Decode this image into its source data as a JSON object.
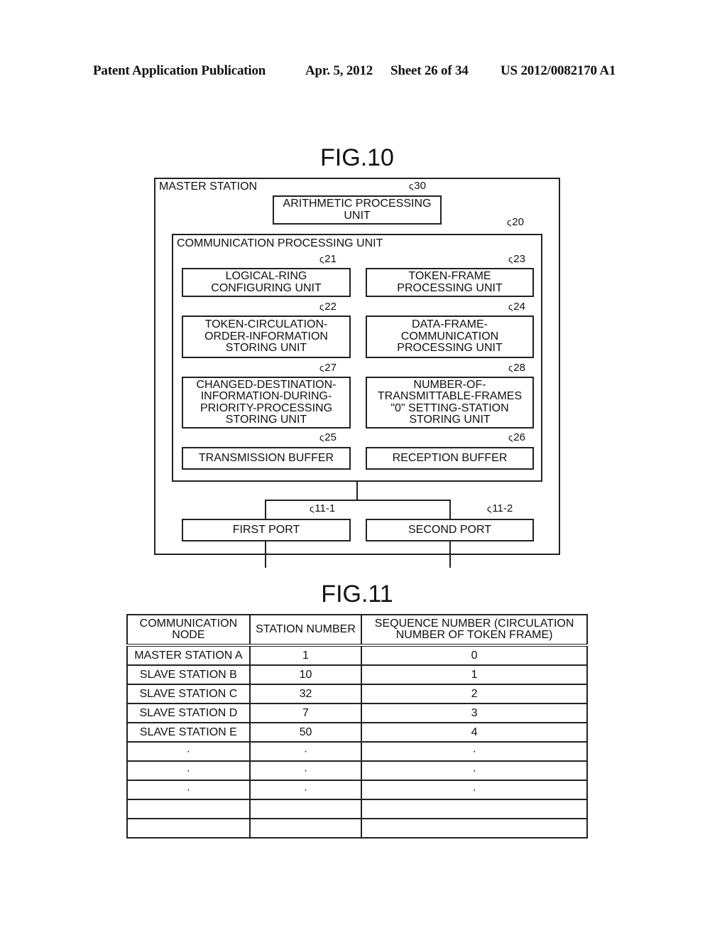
{
  "header": {
    "publication": "Patent Application Publication",
    "date": "Apr. 5, 2012",
    "sheet": "Sheet 26 of 34",
    "number": "US 2012/0082170 A1"
  },
  "fig10": {
    "title": "FIG.10",
    "master_station": "MASTER STATION",
    "arithmetic": {
      "label": "ARITHMETIC PROCESSING\nUNIT",
      "ref": "30"
    },
    "comm_unit": {
      "label": "COMMUNICATION PROCESSING UNIT",
      "ref": "20"
    },
    "blocks": [
      {
        "label": "LOGICAL-RING\nCONFIGURING UNIT",
        "ref": "21"
      },
      {
        "label": "TOKEN-FRAME\nPROCESSING UNIT",
        "ref": "23"
      },
      {
        "label": "TOKEN-CIRCULATION-\nORDER-INFORMATION\nSTORING UNIT",
        "ref": "22"
      },
      {
        "label": "DATA-FRAME-\nCOMMUNICATION\nPROCESSING UNIT",
        "ref": "24"
      },
      {
        "label": "CHANGED-DESTINATION-\nINFORMATION-DURING-\nPRIORITY-PROCESSING\nSTORING UNIT",
        "ref": "27"
      },
      {
        "label": "NUMBER-OF-\nTRANSMITTABLE-FRAMES\n\"0\" SETTING-STATION\nSTORING UNIT",
        "ref": "28"
      },
      {
        "label": "TRANSMISSION BUFFER",
        "ref": "25"
      },
      {
        "label": "RECEPTION BUFFER",
        "ref": "26"
      }
    ],
    "ports": [
      {
        "label": "FIRST PORT",
        "ref": "11-1"
      },
      {
        "label": "SECOND PORT",
        "ref": "11-2"
      }
    ]
  },
  "fig11": {
    "title": "FIG.11",
    "columns": [
      "COMMUNICATION\nNODE",
      "STATION NUMBER",
      "SEQUENCE NUMBER (CIRCULATION\nNUMBER OF TOKEN FRAME)"
    ],
    "rows": [
      [
        "MASTER STATION A",
        "1",
        "0"
      ],
      [
        "SLAVE STATION B",
        "10",
        "1"
      ],
      [
        "SLAVE STATION C",
        "32",
        "2"
      ],
      [
        "SLAVE STATION D",
        "7",
        "3"
      ],
      [
        "SLAVE STATION E",
        "50",
        "4"
      ],
      [
        "·",
        "·",
        "·"
      ],
      [
        "·",
        "·",
        "·"
      ],
      [
        "·",
        "·",
        "·"
      ],
      [
        "",
        "",
        ""
      ],
      [
        "",
        "",
        ""
      ]
    ]
  }
}
